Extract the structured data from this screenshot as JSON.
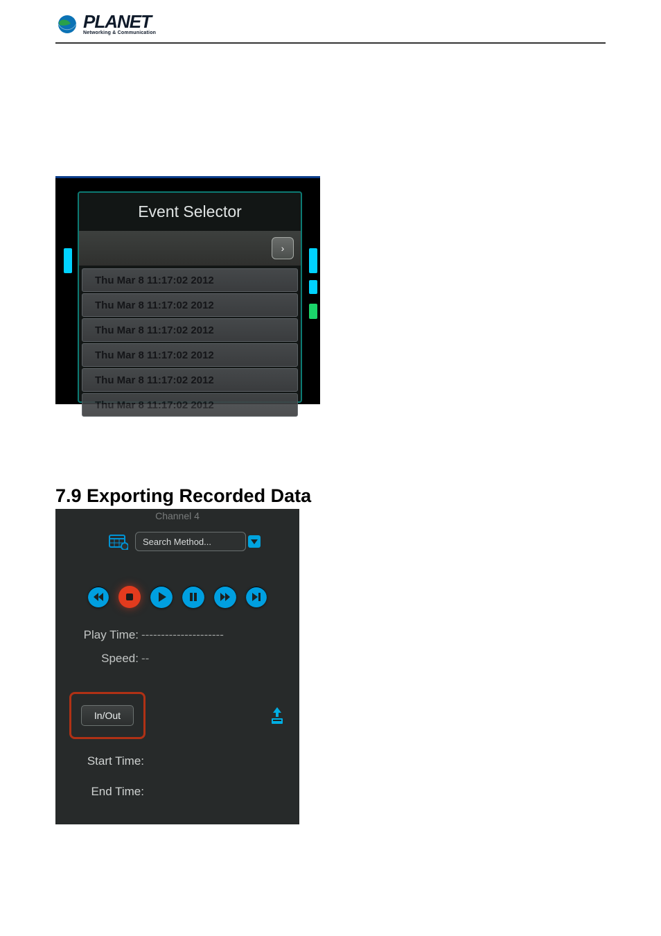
{
  "header": {
    "brand_word": "PLANET",
    "brand_tagline": "Networking & Communication"
  },
  "event_selector": {
    "title": "Event Selector",
    "next_glyph": "›",
    "items": [
      "Thu Mar 8 11:17:02 2012",
      "Thu Mar 8 11:17:02 2012",
      "Thu Mar 8 11:17:02 2012",
      "Thu Mar 8 11:17:02 2012",
      "Thu Mar 8 11:17:02 2012",
      "Thu Mar 8 11:17:02 2012"
    ]
  },
  "section_heading": "7.9 Exporting Recorded Data",
  "playback": {
    "cut_label": "Channel 4",
    "search_method": "Search Method...",
    "play_time_label": "Play Time:",
    "play_time_value": "---------------------",
    "speed_label": "Speed:",
    "speed_value": "--",
    "inout_label": "In/Out",
    "start_time_label": "Start Time:",
    "end_time_label": "End Time:"
  }
}
